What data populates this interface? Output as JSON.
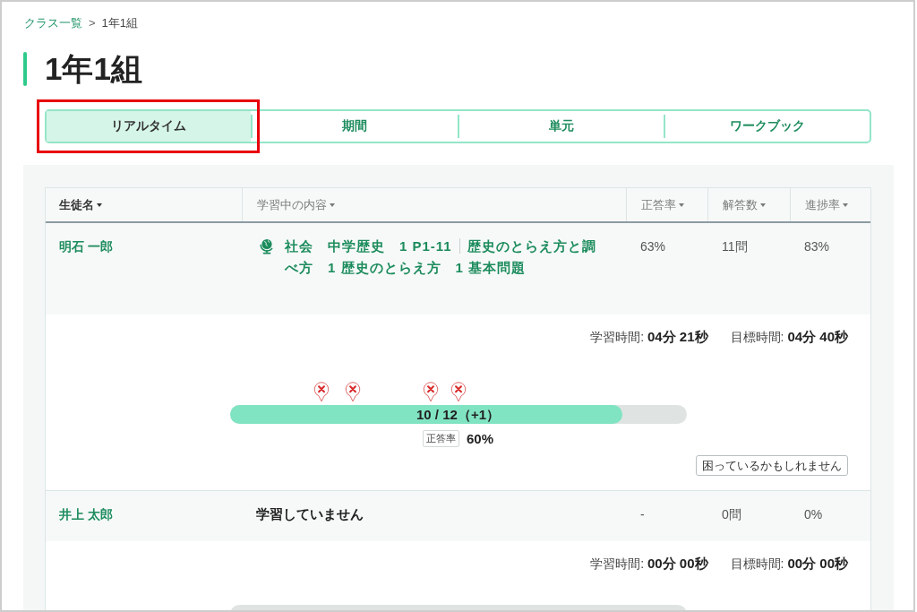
{
  "breadcrumb": {
    "items": [
      {
        "label": "クラス一覧",
        "kind": "link"
      },
      {
        "label": "1年1組",
        "kind": "current"
      }
    ],
    "separator": ">"
  },
  "title": "1年1組",
  "tabs": [
    {
      "label": "リアルタイム",
      "selected": true,
      "highlighted": true
    },
    {
      "label": "期間",
      "selected": false,
      "highlighted": false
    },
    {
      "label": "単元",
      "selected": false,
      "highlighted": false
    },
    {
      "label": "ワークブック",
      "selected": false,
      "highlighted": false
    }
  ],
  "table": {
    "columns": [
      {
        "label": "生徒名",
        "sorted": true
      },
      {
        "label": "学習中の内容",
        "sorted": false
      },
      {
        "label": "正答率",
        "sorted": false
      },
      {
        "label": "解答数",
        "sorted": false
      },
      {
        "label": "進捗率",
        "sorted": false
      }
    ],
    "rows": [
      {
        "name": "明石 一郎",
        "activity": {
          "kind": "unit",
          "parts": [
            "社会　中学歴史　1 P1-11",
            "歴史のとらえ方と調べ方　1 歴史のとらえ方　1 基本問題"
          ]
        },
        "correct_rate": "63%",
        "answer_count": "11問",
        "progress_rate": "83%",
        "detail": {
          "study_time": {
            "label": "学習時間:",
            "value": "04分 21秒"
          },
          "target_time": {
            "label": "目標時間:",
            "value": "04分 40秒"
          },
          "marks": [
            {
              "kind": "wrong",
              "level": 0.2
            },
            {
              "kind": "wrong",
              "level": 0.27
            },
            {
              "kind": "wrong",
              "level": 0.44
            },
            {
              "kind": "wrong",
              "level": 0.5
            }
          ],
          "progress": {
            "level": 0.86,
            "label": "10 / 12（+1）"
          },
          "score": {
            "tag": "正答率",
            "value": "60%"
          },
          "alert": "困っているかもしれません"
        }
      },
      {
        "name": "井上 太郎",
        "activity": {
          "kind": "none",
          "text": "学習していません"
        },
        "correct_rate": "-",
        "answer_count": "0問",
        "progress_rate": "0%",
        "detail": {
          "study_time": {
            "label": "学習時間:",
            "value": "00分 00秒"
          },
          "target_time": {
            "label": "目標時間:",
            "value": "00分 00秒"
          },
          "progress": {
            "level": 0
          }
        }
      }
    ]
  }
}
